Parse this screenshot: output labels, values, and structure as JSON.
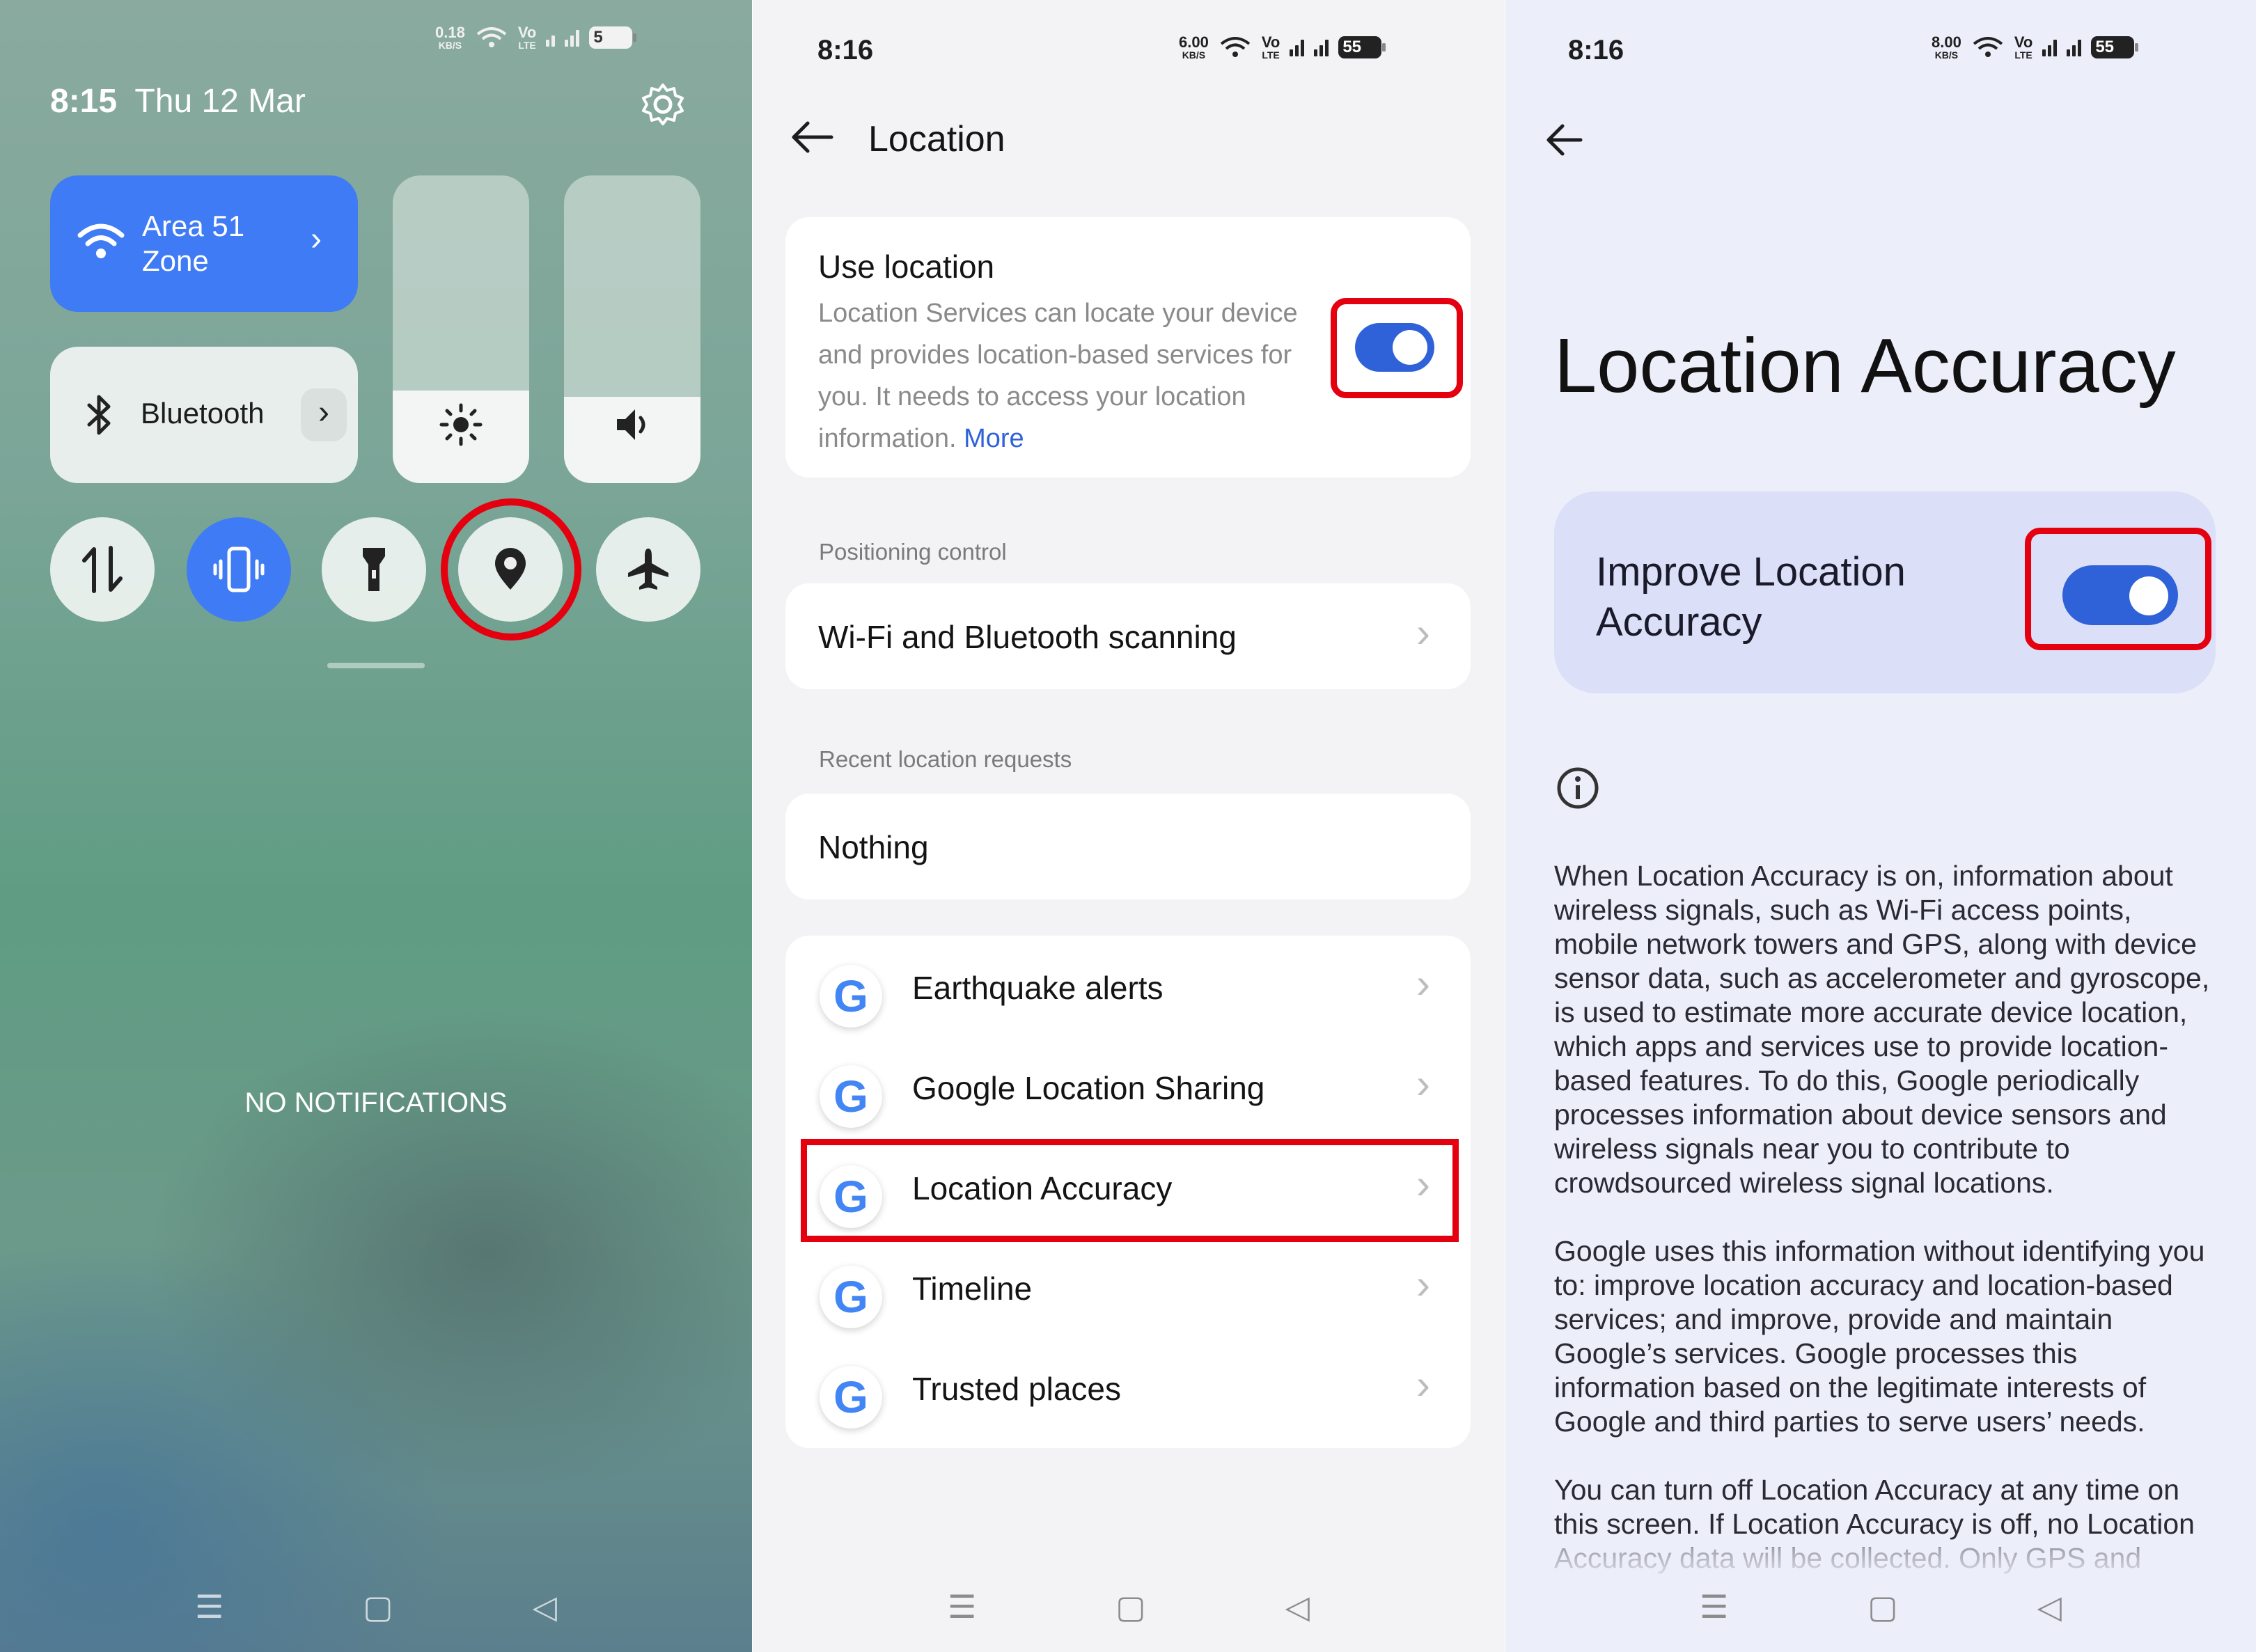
{
  "screen1": {
    "status_speed": "0.18",
    "status_speed_unit": "KB/S",
    "battery": "5",
    "time": "8:15",
    "date": "Thu 12 Mar",
    "wifi_tile_label": "Area 51 Zone",
    "wifi_line1": "Area 51",
    "wifi_line2": "Zone",
    "bluetooth_label": "Bluetooth",
    "brightness_level": 0.3,
    "volume_level": 0.28,
    "notifications_text": "NO NOTIFICATIONS"
  },
  "screen2": {
    "time": "8:16",
    "status_speed": "6.00",
    "status_speed_unit": "KB/S",
    "battery": "55",
    "title": "Location",
    "use_location_title": "Use location",
    "use_location_desc": "Location Services can locate your device and provides location-based services for you. It needs to access your location information.",
    "more_link": "More",
    "positioning_header": "Positioning control",
    "wifi_bt_scanning": "Wi-Fi and Bluetooth scanning",
    "recent_header": "Recent location requests",
    "nothing": "Nothing",
    "services": [
      "Earthquake alerts",
      "Google Location Sharing",
      "Location Accuracy",
      "Timeline",
      "Trusted places"
    ]
  },
  "screen3": {
    "time": "8:16",
    "status_speed": "8.00",
    "status_speed_unit": "KB/S",
    "battery": "55",
    "title": "Location Accuracy",
    "toggle_label": "Improve Location Accuracy",
    "para1": "When Location Accuracy is on, information about wireless signals, such as Wi-Fi access points, mobile network towers and GPS, along with device sensor data, such as accelerometer and gyroscope, is used to estimate more accurate device location, which apps and services use to provide location-based features. To do this, Google periodically processes information about device sensors and wireless signals near you to contribute to crowdsourced wireless signal locations.",
    "para2": "Google uses this information without identifying you to: improve location accuracy and location-based services; and improve, provide and maintain Google’s services. Google processes this information based on the legitimate interests of Google and third parties to serve users’ needs.",
    "para3": "You can turn off Location Accuracy at any time on this screen. If Location Accuracy is off, no Location Accuracy data will be collected. Only GPS and"
  },
  "colors": {
    "accent_blue": "#3f7bf5",
    "toggle_blue": "#2f61d9",
    "highlight_red": "#e4000f",
    "link_blue": "#2f61d9"
  },
  "icons": {
    "wifi": "wifi-icon",
    "bluetooth": "bluetooth-icon",
    "settings": "gear-icon",
    "brightness": "sun-icon",
    "volume": "speaker-icon",
    "data": "mobile-data-icon",
    "vibrate": "vibrate-icon",
    "flashlight": "flashlight-icon",
    "location": "location-pin-icon",
    "airplane": "airplane-icon",
    "back": "back-arrow-icon",
    "info": "info-icon",
    "google": "google-logo-icon"
  }
}
